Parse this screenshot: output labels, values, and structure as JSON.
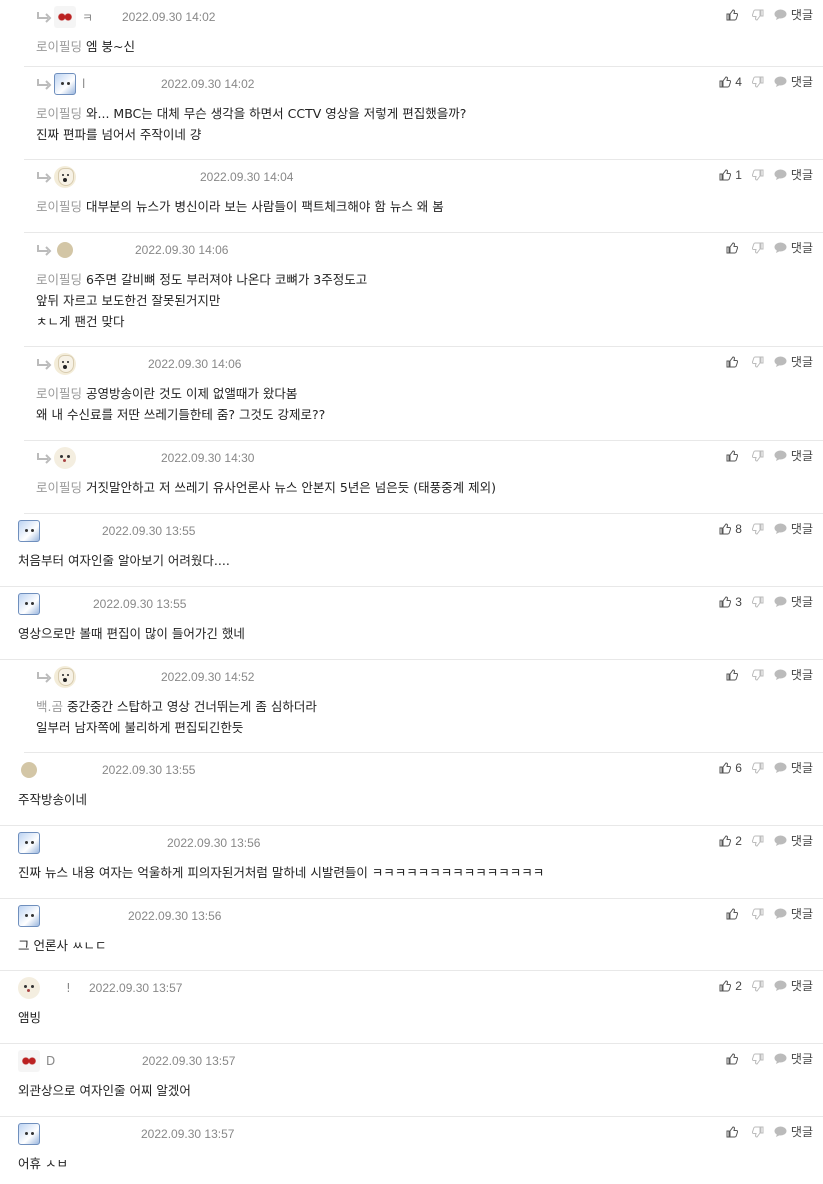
{
  "reply_label": "댓글",
  "comments": [
    {
      "nick": "ㅋ",
      "date": "2022.09.30 14:02",
      "tag": "로이필딩",
      "lines": [
        "엠 붕~신"
      ],
      "likes": ""
    },
    {
      "nick": "l",
      "date": "2022.09.30 14:02",
      "tag": "로이필딩",
      "lines": [
        "와... MBC는 대체 무슨 생각을 하면서 CCTV 영상을 저렇게 편집했을까?",
        "진짜 편파를 넘어서 주작이네 걍"
      ],
      "likes": "4"
    },
    {
      "nick": "",
      "date": "2022.09.30 14:04",
      "tag": "로이필딩",
      "lines": [
        "대부분의 뉴스가 병신이라 보는 사람들이 팩트체크해야 함 뉴스 왜 봄"
      ],
      "likes": "1"
    },
    {
      "nick": "",
      "date": "2022.09.30 14:06",
      "tag": "로이필딩",
      "lines": [
        "6주면 갈비뼈 정도 부러져야 나온다 코뼈가 3주정도고",
        "앞뒤 자르고 보도한건 잘못된거지만",
        "ㅊㄴ게 팬건 맞다"
      ],
      "likes": ""
    },
    {
      "nick": "",
      "date": "2022.09.30 14:06",
      "tag": "로이필딩",
      "lines": [
        "공영방송이란 것도 이제 없앨때가 왔다봄",
        "왜 내 수신료를 저딴 쓰레기들한테 줌? 그것도 강제로??"
      ],
      "likes": ""
    },
    {
      "nick": "",
      "date": "2022.09.30 14:30",
      "tag": "로이필딩",
      "lines": [
        "거짓말안하고 저 쓰레기 유사언론사 뉴스 안본지 5년은 넘은듯 (태풍중계 제외)"
      ],
      "likes": ""
    },
    {
      "nick": "",
      "date": "2022.09.30 13:55",
      "tag": "",
      "lines": [
        "처음부터 여자인줄 알아보기 어려웠다...."
      ],
      "likes": "8"
    },
    {
      "nick": "",
      "date": "2022.09.30 13:55",
      "tag": "",
      "lines": [
        "영상으로만 볼때 편집이 많이 들어가긴 했네"
      ],
      "likes": "3"
    },
    {
      "nick": "",
      "date": "2022.09.30 14:52",
      "tag": "백.곰",
      "lines": [
        "중간중간 스탑하고 영상 건너뛰는게 좀 심하더라",
        "일부러 남자쪽에 불리하게 편집되긴한듯"
      ],
      "likes": ""
    },
    {
      "nick": "",
      "date": "2022.09.30 13:55",
      "tag": "",
      "lines": [
        "주작방송이네"
      ],
      "likes": "6"
    },
    {
      "nick": "",
      "date": "2022.09.30 13:56",
      "tag": "",
      "lines": [
        "진짜 뉴스 내용 여자는 억울하게 피의자된거처럼 말하네 시발련들이 ㅋㅋㅋㅋㅋㅋㅋㅋㅋㅋㅋㅋㅋㅋㅋ"
      ],
      "likes": "2"
    },
    {
      "nick": "",
      "date": "2022.09.30 13:56",
      "tag": "",
      "lines": [
        "그 언론사 ㅆㄴㄷ"
      ],
      "likes": ""
    },
    {
      "nick": "!",
      "date": "2022.09.30 13:57",
      "tag": "",
      "lines": [
        "앰빙"
      ],
      "likes": "2"
    },
    {
      "nick": "D",
      "date": "2022.09.30 13:57",
      "tag": "",
      "lines": [
        "외관상으로 여자인줄 어찌 알겠어"
      ],
      "likes": ""
    },
    {
      "nick": "",
      "date": "2022.09.30 13:57",
      "tag": "",
      "lines": [
        "어휴 ㅅㅂ"
      ],
      "likes": ""
    }
  ]
}
